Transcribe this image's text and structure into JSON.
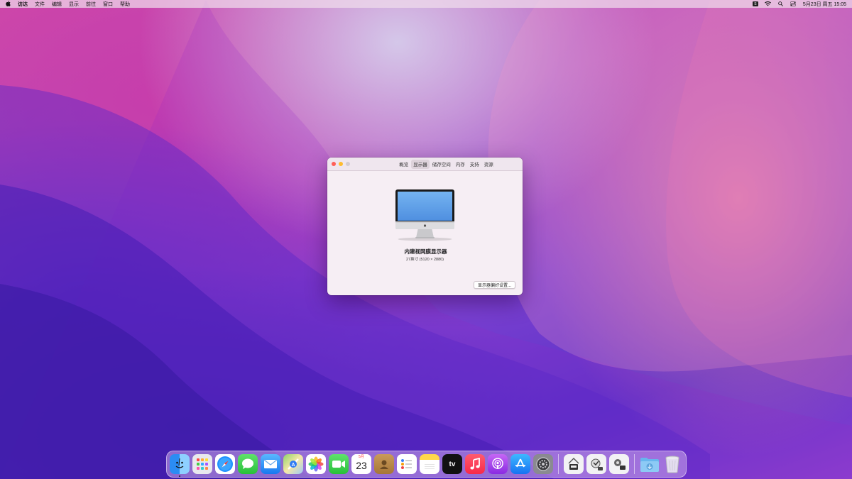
{
  "menubar": {
    "app_name": "访达",
    "menus": [
      "文件",
      "编辑",
      "显示",
      "前往",
      "窗口",
      "帮助"
    ],
    "input_badge": "S",
    "datetime": "5月23日 周五  15:05"
  },
  "about_window": {
    "tabs": [
      {
        "label": "概览",
        "active": false
      },
      {
        "label": "显示器",
        "active": true
      },
      {
        "label": "储存空间",
        "active": false
      },
      {
        "label": "内存",
        "active": false
      },
      {
        "label": "支持",
        "active": false
      },
      {
        "label": "资源",
        "active": false
      }
    ],
    "display_name": "内建视网膜显示器",
    "display_spec": "27英寸 (5120 × 2880)",
    "prefs_button": "显示器偏好设置..."
  },
  "dock": {
    "calendar_month": "5月",
    "calendar_day": "23",
    "tv_label": "tv",
    "items": [
      {
        "name": "finder-icon",
        "running": true
      },
      {
        "name": "launchpad-icon",
        "running": false
      },
      {
        "name": "safari-icon",
        "running": false
      },
      {
        "name": "messages-icon",
        "running": false
      },
      {
        "name": "mail-icon",
        "running": false
      },
      {
        "name": "maps-icon",
        "running": false
      },
      {
        "name": "photos-icon",
        "running": false
      },
      {
        "name": "facetime-icon",
        "running": false
      },
      {
        "name": "calendar-icon",
        "running": false
      },
      {
        "name": "contacts-icon",
        "running": false
      },
      {
        "name": "reminders-icon",
        "running": false
      },
      {
        "name": "notes-icon",
        "running": false
      },
      {
        "name": "apple-tv-icon",
        "running": false
      },
      {
        "name": "music-icon",
        "running": false
      },
      {
        "name": "podcasts-icon",
        "running": false
      },
      {
        "name": "app-store-icon",
        "running": false
      },
      {
        "name": "system-preferences-icon",
        "running": false
      },
      {
        "name": "utility-app-1-icon",
        "running": false
      },
      {
        "name": "utility-app-2-icon",
        "running": false
      },
      {
        "name": "utility-app-3-icon",
        "running": false
      },
      {
        "name": "downloads-folder-icon",
        "running": false
      },
      {
        "name": "trash-icon",
        "running": false
      }
    ]
  },
  "colors": {
    "close": "#ff5f57",
    "minimize": "#febc2e",
    "zoom_disabled": "#d3cbd1",
    "window_bg": "#f6eef4"
  }
}
